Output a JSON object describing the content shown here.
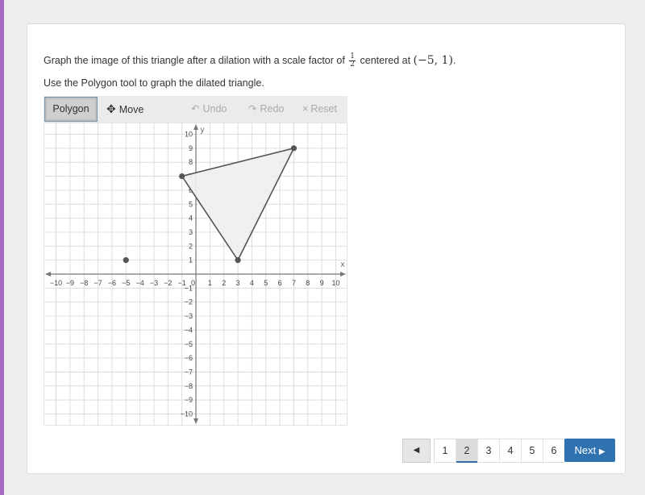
{
  "question": {
    "line1_prefix": "Graph the image of this triangle after a dilation with a scale factor of",
    "fraction_num": "1",
    "fraction_den": "2",
    "line1_mid": "centered at",
    "center_text": "(−5, 1)",
    "line1_suffix": ".",
    "line2": "Use the Polygon tool to graph the dilated triangle."
  },
  "toolbar": {
    "polygon_label": "Polygon",
    "move_label": "Move",
    "move_icon": "✥",
    "undo_label": "Undo",
    "undo_icon": "↶",
    "redo_label": "Redo",
    "redo_icon": "↷",
    "reset_label": "Reset",
    "reset_icon": "×"
  },
  "chart_data": {
    "type": "scatter",
    "title": "",
    "xlabel": "x",
    "ylabel": "y",
    "xlim": [
      -10,
      10
    ],
    "ylim": [
      -10,
      10
    ],
    "grid": true,
    "x_ticks": [
      -10,
      -9,
      -8,
      -7,
      -6,
      -5,
      -4,
      -3,
      -2,
      -1,
      1,
      2,
      3,
      4,
      5,
      6,
      7,
      8,
      9,
      10
    ],
    "y_ticks": [
      -10,
      -9,
      -8,
      -7,
      -6,
      -5,
      -4,
      -3,
      -2,
      -1,
      1,
      2,
      3,
      4,
      5,
      6,
      7,
      8,
      9,
      10
    ],
    "origin_label": "0",
    "triangle": [
      [
        -1,
        7
      ],
      [
        7,
        9
      ],
      [
        3,
        1
      ]
    ],
    "center_point": [
      -5,
      1
    ],
    "colors": {
      "fill": "#eeeeee",
      "stroke": "#555555",
      "point": "#555555",
      "grid": "#dddddd",
      "axis": "#777777"
    }
  },
  "pagination": {
    "prev_icon": "◀",
    "pages": [
      "1",
      "2",
      "3",
      "4",
      "5",
      "6"
    ],
    "active_page": "2",
    "next_label": "Next",
    "next_icon": "▶"
  },
  "colors": {
    "accent_bar": "#a66bc6",
    "next_button": "#2f72b0"
  }
}
